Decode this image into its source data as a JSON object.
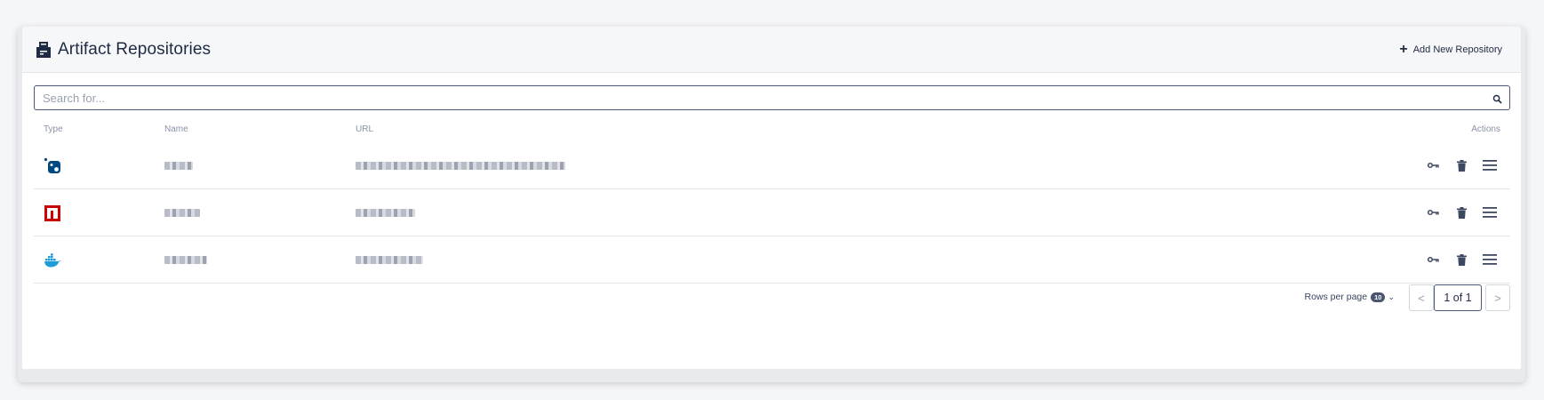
{
  "header": {
    "title": "Artifact Repositories",
    "add_label": "Add New Repository",
    "icon": "repository-icon"
  },
  "search": {
    "placeholder": "Search for...",
    "value": ""
  },
  "table": {
    "columns": {
      "type": "Type",
      "name": "Name",
      "url": "URL",
      "actions": "Actions"
    },
    "rows": [
      {
        "type_icon": "nuget-icon",
        "type_color": "#004880"
      },
      {
        "type_icon": "npm-icon",
        "type_color": "#cb0000"
      },
      {
        "type_icon": "docker-icon",
        "type_color": "#1d9cd8"
      }
    ]
  },
  "pagination": {
    "rows_per_page_label": "Rows per page",
    "rows_per_page_value": "10",
    "prev_label": "<",
    "next_label": ">",
    "page_label": "1 of 1"
  },
  "colors": {
    "accent": "#4a567a",
    "text": "#1f2a44",
    "muted": "#8a92a5"
  }
}
